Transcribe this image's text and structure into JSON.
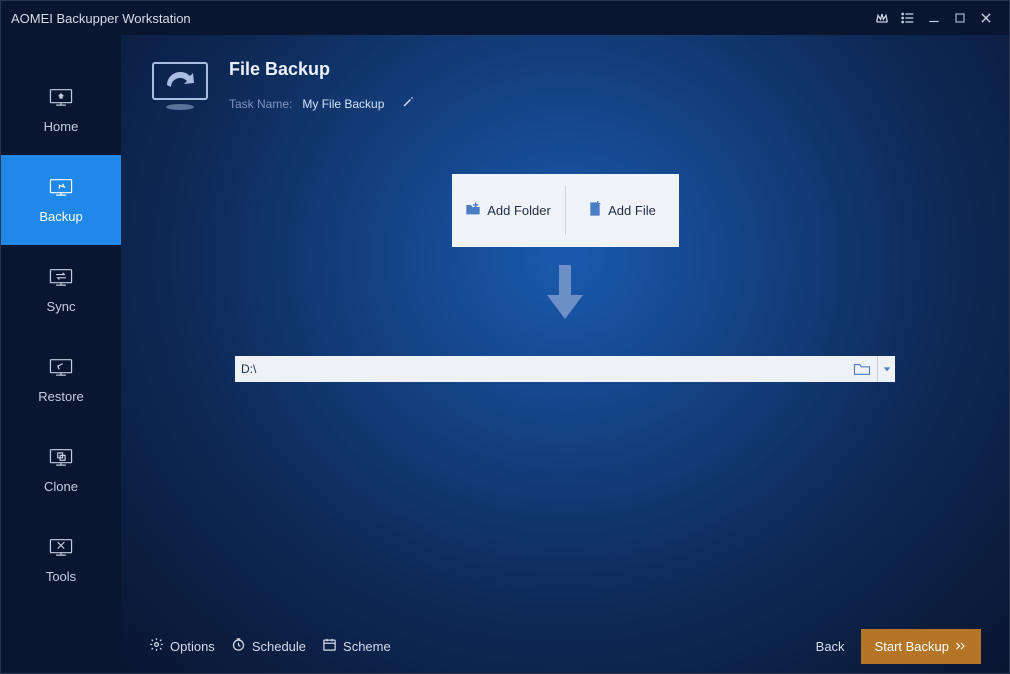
{
  "app": {
    "title": "AOMEI Backupper Workstation"
  },
  "sidebar": {
    "items": [
      {
        "label": "Home"
      },
      {
        "label": "Backup"
      },
      {
        "label": "Sync"
      },
      {
        "label": "Restore"
      },
      {
        "label": "Clone"
      },
      {
        "label": "Tools"
      }
    ]
  },
  "header": {
    "title": "File Backup",
    "task_label": "Task Name:",
    "task_value": "My File Backup"
  },
  "add": {
    "folder_label": "Add Folder",
    "file_label": "Add File"
  },
  "destination": {
    "path": "D:\\"
  },
  "footer": {
    "options": "Options",
    "schedule": "Schedule",
    "scheme": "Scheme",
    "back": "Back",
    "start": "Start Backup"
  }
}
